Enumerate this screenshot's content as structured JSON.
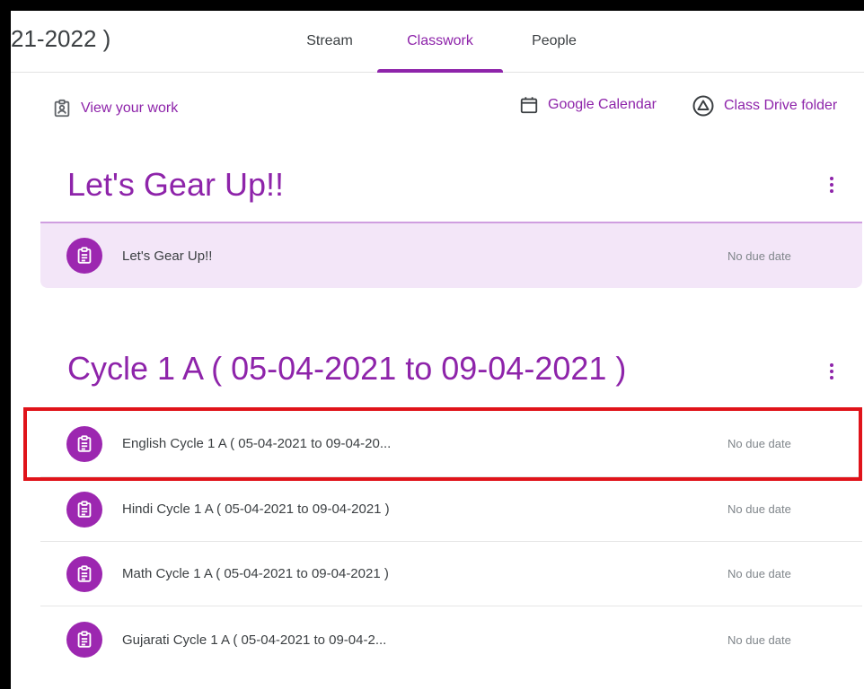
{
  "header": {
    "class_title": "21-2022 )",
    "tabs": [
      {
        "label": "Stream"
      },
      {
        "label": "Classwork"
      },
      {
        "label": "People"
      }
    ]
  },
  "actions": {
    "view_work": "View your work",
    "calendar": "Google Calendar",
    "drive": "Class Drive folder"
  },
  "topics": [
    {
      "title": "Let's Gear Up!!",
      "items": [
        {
          "title": "Let's Gear Up!!",
          "due": "No due date"
        }
      ]
    },
    {
      "title": "Cycle 1 A ( 05-04-2021 to 09-04-2021 )",
      "items": [
        {
          "title": "English Cycle 1 A ( 05-04-2021 to 09-04-20...",
          "due": "No due date"
        },
        {
          "title": "Hindi Cycle 1 A ( 05-04-2021 to 09-04-2021 )",
          "due": "No due date"
        },
        {
          "title": "Math Cycle 1 A ( 05-04-2021 to 09-04-2021 )",
          "due": "No due date"
        },
        {
          "title": "Gujarati Cycle 1 A ( 05-04-2021 to 09-04-2...",
          "due": "No due date"
        }
      ]
    }
  ],
  "colors": {
    "accent": "#8e24aa",
    "icon_bg": "#9c27b0",
    "highlight_row": "#f3e6f8",
    "annotation_box": "#e0131a"
  }
}
